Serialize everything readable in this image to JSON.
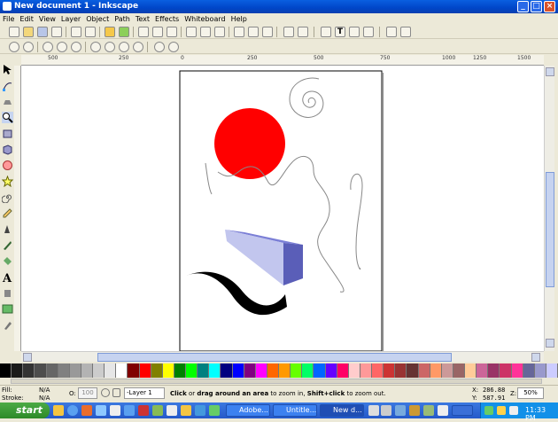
{
  "window": {
    "title": "New document 1 - Inkscape"
  },
  "menu": [
    "File",
    "Edit",
    "View",
    "Layer",
    "Object",
    "Path",
    "Text",
    "Effects",
    "Whiteboard",
    "Help"
  ],
  "ruler": {
    "labels": [
      "500",
      "250",
      "0",
      "250",
      "500",
      "750",
      "1000",
      "1250",
      "1500"
    ]
  },
  "colors": {
    "titlebar": "#0a5fe0",
    "circle_fill": "#ff0000",
    "box_top": "#7b7fd6",
    "box_side": "#5a5eb8",
    "box_front": "#c2c6ee"
  },
  "palette": [
    "#000000",
    "#1a1a1a",
    "#333333",
    "#4d4d4d",
    "#666666",
    "#808080",
    "#999999",
    "#b3b3b3",
    "#cccccc",
    "#e6e6e6",
    "#ffffff",
    "#800000",
    "#ff0000",
    "#808000",
    "#ffff00",
    "#008000",
    "#00ff00",
    "#008080",
    "#00ffff",
    "#000080",
    "#0000ff",
    "#800080",
    "#ff00ff",
    "#ff6600",
    "#ff9900",
    "#66ff00",
    "#00ff66",
    "#0066ff",
    "#6600ff",
    "#ff0066",
    "#ffcccc",
    "#ff9999",
    "#ff6666",
    "#cc3333",
    "#993333",
    "#663333",
    "#cc6666",
    "#ff9966",
    "#cc9999",
    "#996666",
    "#ffcc99",
    "#cc6699",
    "#993366",
    "#cc3366",
    "#ff3399",
    "#666699",
    "#9999cc",
    "#ccccff"
  ],
  "status": {
    "fill_label": "Fill:",
    "fill_value": "N/A",
    "stroke_label": "Stroke:",
    "stroke_value": "N/A",
    "opacity_label": "O:",
    "opacity_value": "100",
    "layer": "-Layer 1",
    "msg_bold1": "Click",
    "msg_1": " or ",
    "msg_bold2": "drag around an area",
    "msg_2": " to zoom in, ",
    "msg_bold3": "Shift+click",
    "msg_3": " to zoom out.",
    "x_label": "X:",
    "x_value": "286.88",
    "y_label": "Y:",
    "y_value": "587.91",
    "zoom_label": "Z:",
    "zoom_value": "50%"
  },
  "taskbar": {
    "start": "start",
    "tasks": [
      "Adobe...",
      "Untitle...",
      "New d..."
    ],
    "clock": "11:33 PM"
  }
}
